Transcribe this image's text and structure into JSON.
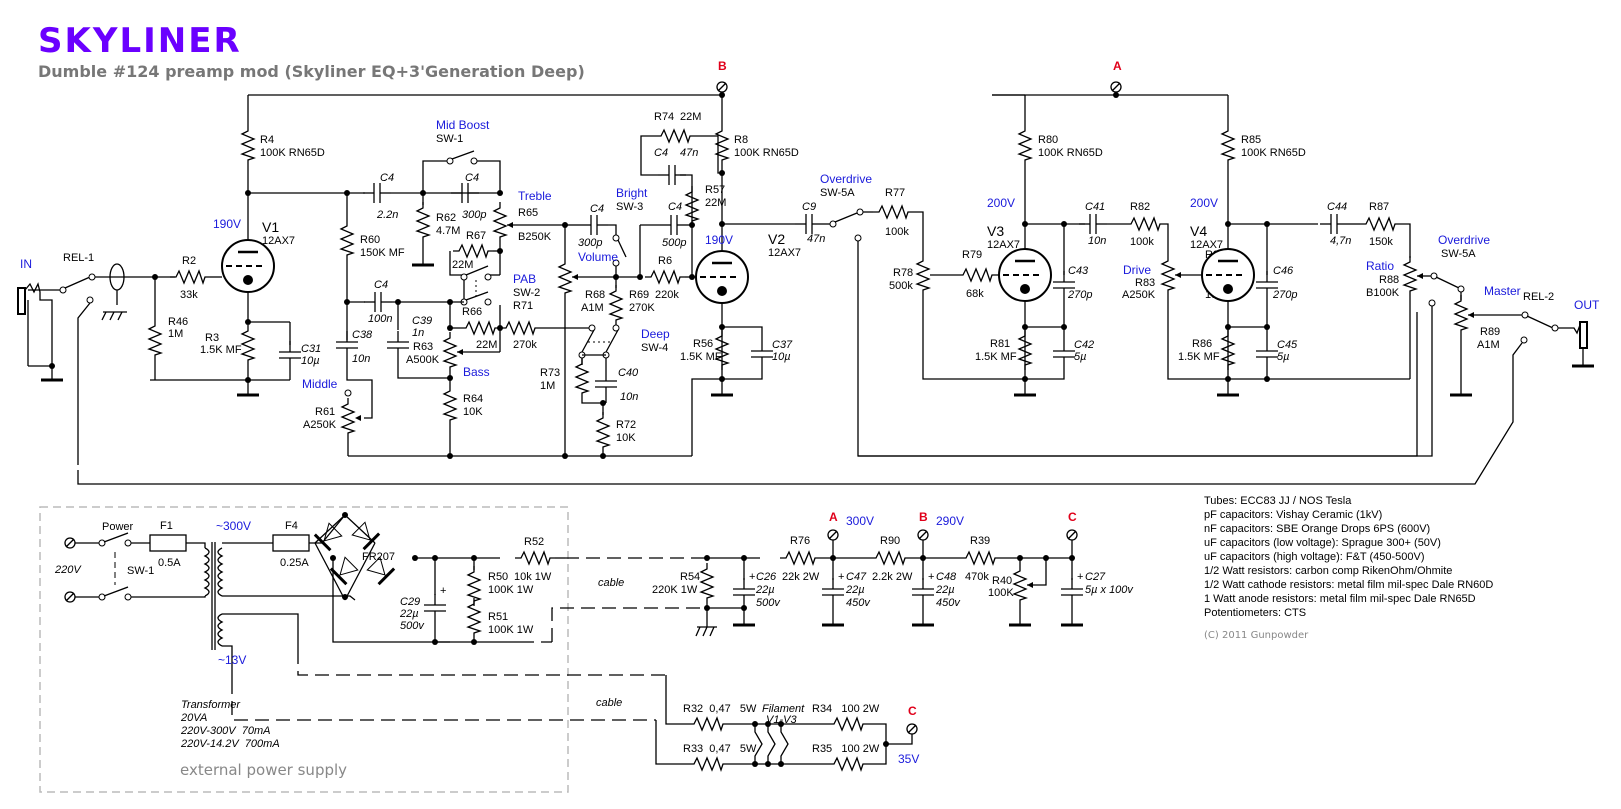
{
  "header": {
    "logo": "SKYLINER",
    "title": "Dumble #124 preamp mod (Skyliner EQ+3'Generation Deep)"
  },
  "colors": {
    "logo": "#6a00ff",
    "annotation_blue": "#1a1adb",
    "node_red": "#e0001a",
    "title_gray": "#777777"
  },
  "io": {
    "in": "IN",
    "out": "OUT",
    "rel1": "REL-1",
    "rel2": "REL-2"
  },
  "nodes": {
    "a": "A",
    "b": "B",
    "c": "C"
  },
  "voltages": {
    "v1": "190V",
    "v2": "190V",
    "v3": "200V",
    "v4": "200V",
    "a": "300V",
    "b": "290V",
    "filament": "35V",
    "hv_ac": "~300V",
    "lv_ac": "~13V",
    "mains": "220V"
  },
  "tubes": [
    {
      "ref": "V1",
      "type": "12AX7"
    },
    {
      "ref": "V2",
      "type": "12AX7"
    },
    {
      "ref": "V3",
      "type": "12AX7"
    },
    {
      "ref": "V4",
      "type": "12AX7"
    }
  ],
  "controls": {
    "mid_boost": "Mid Boost",
    "sw1": "SW-1",
    "treble": "Treble",
    "bass": "Bass",
    "middle": "Middle",
    "pab": "PAB",
    "sw2": "SW-2",
    "bright": "Bright",
    "sw3": "SW-3",
    "volume": "Volume",
    "deep": "Deep",
    "sw4": "SW-4",
    "overdrive": "Overdrive",
    "sw5a": "SW-5A",
    "drive": "Drive",
    "ratio": "Ratio",
    "master": "Master"
  },
  "components": {
    "R4": [
      "R4",
      "100K RN65D"
    ],
    "R2": [
      "R2",
      "33k"
    ],
    "R46": [
      "R46",
      "1M"
    ],
    "R3": [
      "R3",
      "1.5K MF"
    ],
    "C31": [
      "C31",
      "10µ"
    ],
    "C4a": [
      "C4",
      "2.2n"
    ],
    "C4b": [
      "C4",
      "300p"
    ],
    "C4c": [
      "C4",
      "100n"
    ],
    "C4d": [
      "C4",
      "300p"
    ],
    "C4e": [
      "C4",
      "47n"
    ],
    "C4f": [
      "C4",
      "500p"
    ],
    "R60": [
      "R60",
      "150K MF"
    ],
    "R62": [
      "R62",
      "4.7M"
    ],
    "R65": [
      "R65",
      "B250K"
    ],
    "R67": [
      "R67",
      "22M"
    ],
    "R66": [
      "R66",
      "22M"
    ],
    "R71": [
      "R71",
      "270k"
    ],
    "C38": [
      "C38",
      "10n"
    ],
    "C39": [
      "C39",
      "1n"
    ],
    "R63": [
      "R63",
      "A500K"
    ],
    "R64": [
      "R64",
      "10K"
    ],
    "R61": [
      "R61",
      "A250K"
    ],
    "R73": [
      "R73",
      "1M"
    ],
    "R68": [
      "R68",
      "A1M"
    ],
    "R69": [
      "R69",
      "270K"
    ],
    "R6": [
      "R6",
      "220k"
    ],
    "C40": [
      "C40",
      "10n"
    ],
    "R72": [
      "R72",
      "10K"
    ],
    "R74": [
      "R74",
      "22M"
    ],
    "R57": [
      "R57",
      "22M"
    ],
    "R8": [
      "R8",
      "100K RN65D"
    ],
    "R56": [
      "R56",
      "1.5K MF"
    ],
    "C37": [
      "C37",
      "10µ"
    ],
    "C9": [
      "C9",
      "47n"
    ],
    "R77": [
      "R77",
      "100k"
    ],
    "R78": [
      "R78",
      "500k"
    ],
    "R79": [
      "R79",
      "68k"
    ],
    "R80": [
      "R80",
      "100K RN65D"
    ],
    "C41": [
      "C41",
      "10n"
    ],
    "R82": [
      "R82",
      "100k"
    ],
    "C43": [
      "C43",
      "270p"
    ],
    "R81": [
      "R81",
      "1.5K MF"
    ],
    "C42": [
      "C42",
      "5µ"
    ],
    "R83": [
      "R83",
      "A250K"
    ],
    "R84": [
      "R84",
      "180k"
    ],
    "R85": [
      "R85",
      "100K RN65D"
    ],
    "C44": [
      "C44",
      "4,7n"
    ],
    "R87": [
      "R87",
      "150k"
    ],
    "C46": [
      "C46",
      "270p"
    ],
    "R86": [
      "R86",
      "1.5K MF"
    ],
    "C45": [
      "C45",
      "5µ"
    ],
    "R88": [
      "R88",
      "B100K"
    ],
    "R89": [
      "R89",
      "A1M"
    ]
  },
  "power_supply": {
    "power": "Power",
    "sw1": "SW-1",
    "F1": [
      "F1",
      "0.5A"
    ],
    "F4": [
      "F4",
      "0.25A"
    ],
    "bridge": "FR207",
    "C29": [
      "C29",
      "22µ",
      "500v"
    ],
    "R52": [
      "R52",
      "10k 1W"
    ],
    "R50": [
      "R50",
      "100K 1W"
    ],
    "R51": [
      "R51",
      "100K 1W"
    ],
    "cable1": "cable",
    "cable2": "cable",
    "R54": [
      "R54",
      "220K 1W"
    ],
    "C26": [
      "C26",
      "22µ",
      "500v"
    ],
    "R76": [
      "R76",
      "22k 2W"
    ],
    "C47": [
      "C47",
      "22µ",
      "450v"
    ],
    "R90": [
      "R90",
      "2.2k 2W"
    ],
    "C48": [
      "C48",
      "22µ",
      "450v"
    ],
    "R39": [
      "R39",
      "470k"
    ],
    "R40": [
      "R40",
      "100K"
    ],
    "C27": [
      "C27",
      "5µ x 100v"
    ],
    "R32": "R32  0,47   5W",
    "R33": "R33  0,47   5W",
    "R34": "R34   100 2W",
    "R35": "R35   100 2W",
    "filament": "Filament",
    "filament_tubes": "V1-V3",
    "transformer": [
      "Transformer",
      "20VA",
      "220V-300V  70mA",
      "220V-14.2V  700mA"
    ],
    "box_label": "external power supply"
  },
  "notes": [
    "Tubes: ECC83 JJ / NOS Tesla",
    "pF capacitors: Vishay Ceramic (1kV)",
    "nF capacitors: SBE Orange Drops 6PS (600V)",
    "uF capacitors (low voltage): Sprague 300+ (50V)",
    "uF capacitors (high voltage): F&T (450-500V)",
    "1/2 Watt resistors: carbon comp RikenOhm/Ohmite",
    "1/2 Watt cathode resistors: metal film mil-spec Dale RN60D",
    "1 Watt anode resistors: metal film mil-spec Dale RN65D",
    "Potentiometers: CTS"
  ],
  "copyright": "(C) 2011 Gunpowder"
}
